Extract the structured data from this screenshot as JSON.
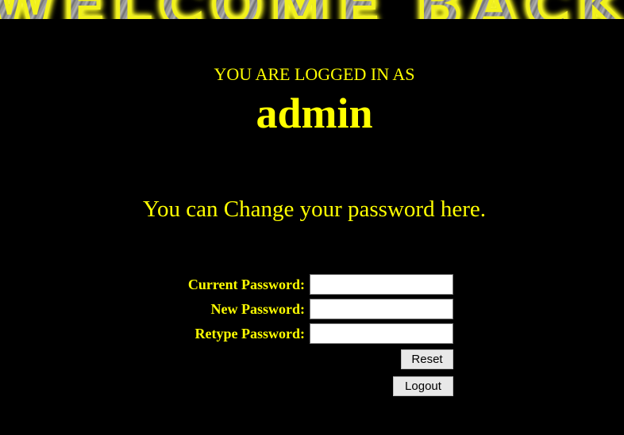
{
  "banner": {
    "text": "WELCOME BACK"
  },
  "session": {
    "logged_in_label": "YOU ARE LOGGED IN AS",
    "username": "admin"
  },
  "message": {
    "change_password": "You can Change your password here."
  },
  "form": {
    "current_password_label": "Current Password:",
    "current_password_value": "",
    "new_password_label": "New Password:",
    "new_password_value": "",
    "retype_password_label": "Retype Password:",
    "retype_password_value": "",
    "reset_label": "Reset",
    "logout_label": "Logout"
  },
  "colors": {
    "background": "#000000",
    "text": "#ffff00",
    "banner_glow": "#ffff00",
    "banner_fill": "#9a9a9a",
    "input_background": "#ffffff",
    "button_background": "#e8e8e8"
  }
}
